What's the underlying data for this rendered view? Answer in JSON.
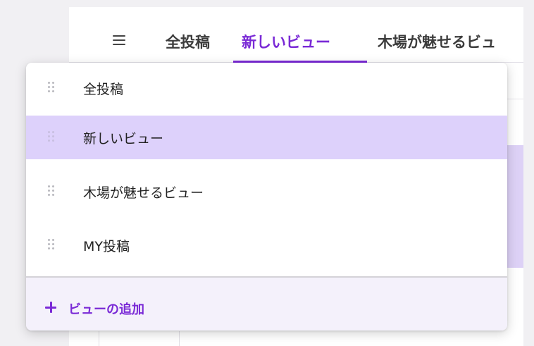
{
  "tabs": [
    {
      "label": "全投稿",
      "active": false
    },
    {
      "label": "新しいビュー",
      "active": true
    },
    {
      "label": "木場が魅せるビュ",
      "active": false
    }
  ],
  "dropdown": {
    "items": [
      {
        "label": "全投稿",
        "selected": false
      },
      {
        "label": "新しいビュー",
        "selected": true
      },
      {
        "label": "木場が魅せるビュー",
        "selected": false
      },
      {
        "label": "MY投稿",
        "selected": false
      }
    ],
    "add_label": "ビューの追加"
  },
  "icons": {
    "menu": "hamburger-menu-icon",
    "drag": "drag-handle-icon",
    "add": "plus-icon"
  },
  "colors": {
    "accent": "#7a2ad6",
    "selected_bg": "#ddd1fb",
    "add_bg": "#f4f1fb"
  }
}
